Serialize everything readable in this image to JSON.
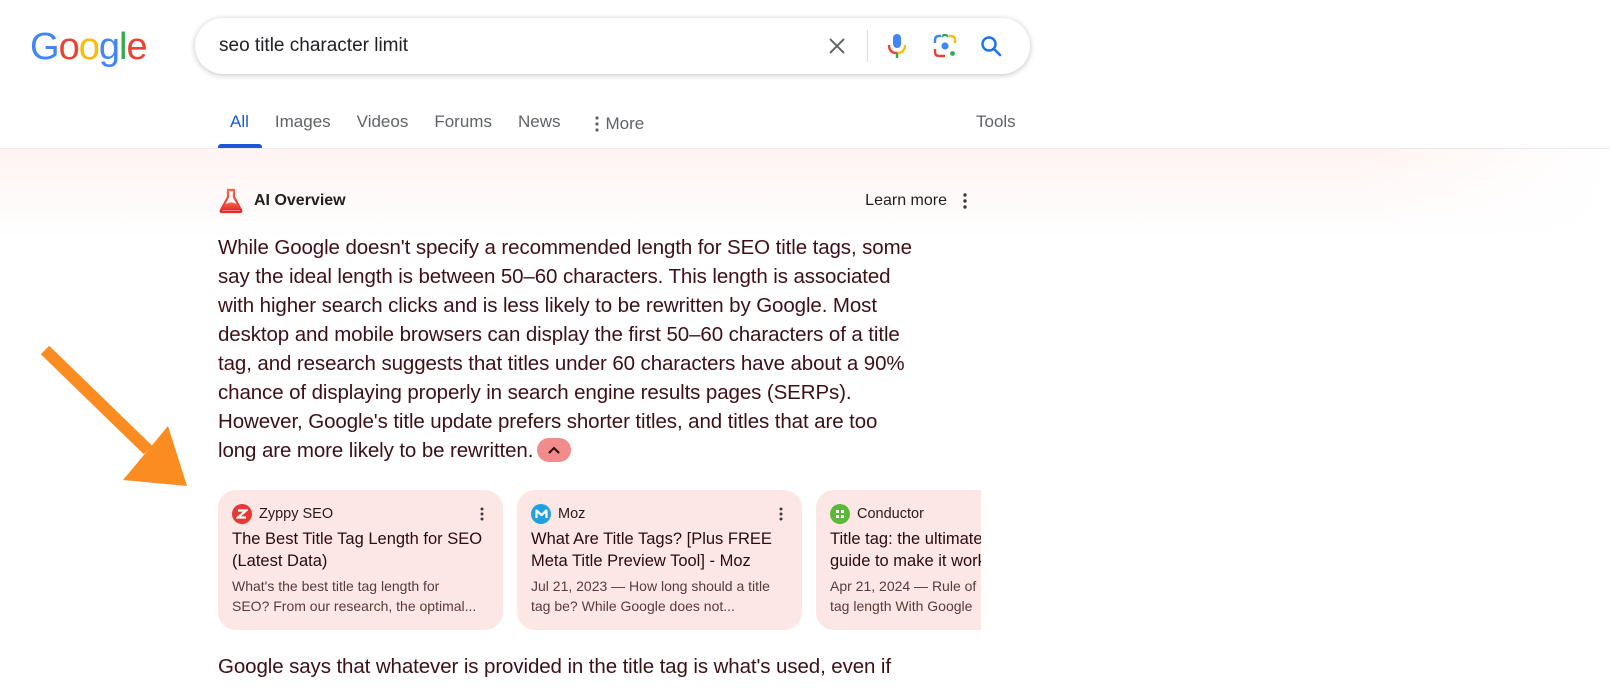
{
  "logo": {
    "text": "Google",
    "letters": [
      {
        "ch": "G",
        "color": "#4285F4"
      },
      {
        "ch": "o",
        "color": "#EA4335"
      },
      {
        "ch": "o",
        "color": "#FBBC05"
      },
      {
        "ch": "g",
        "color": "#4285F4"
      },
      {
        "ch": "l",
        "color": "#34A853"
      },
      {
        "ch": "e",
        "color": "#EA4335"
      }
    ]
  },
  "search": {
    "query": "seo title character limit",
    "icons": [
      "clear-icon",
      "microphone-icon",
      "google-lens-icon",
      "search-icon"
    ]
  },
  "tabs": [
    {
      "label": "All",
      "active": true
    },
    {
      "label": "Images",
      "active": false
    },
    {
      "label": "Videos",
      "active": false
    },
    {
      "label": "Forums",
      "active": false
    },
    {
      "label": "News",
      "active": false
    },
    {
      "label": "More",
      "active": false
    }
  ],
  "tools_label": "Tools",
  "ai_overview": {
    "title": "AI Overview",
    "learn_more": "Learn more",
    "body": "While Google doesn't specify a recommended length for SEO title tags, some say the ideal length is between 50–60 characters. This length is associated with higher search clicks and is less likely to be rewritten by Google. Most desktop and mobile browsers can display the first 50–60 characters of a title tag, and research suggests that titles under 60 characters have about a 90% chance of displaying properly in search engine results pages (SERPs). However, Google's title update prefers shorter titles, and titles that are too long are more likely to be rewritten.",
    "body_lines": [
      "While Google doesn't specify a recommended length for SEO title tags, some",
      "say the ideal length is between 50–60 characters. This length is associated",
      "with higher search clicks and is less likely to be rewritten by Google. Most",
      "desktop and mobile browsers can display the first 50–60 characters of a title",
      "tag, and research suggests that titles under 60 characters have about a 90%",
      "chance of displaying properly in search engine results pages (SERPs).",
      "However, Google's title update prefers shorter titles, and titles that are too",
      "long are more likely to be rewritten."
    ],
    "sources": [
      {
        "site": "Zyppy SEO",
        "title_lines": [
          "The Best Title Tag Length for SEO",
          "(Latest Data)"
        ],
        "snippet_lines": [
          "What's the best title tag length for",
          "SEO? From our research, the optimal..."
        ],
        "favicon_color": "#e53935"
      },
      {
        "site": "Moz",
        "title_lines": [
          "What Are Title Tags? [Plus FREE",
          "Meta Title Preview Tool] - Moz"
        ],
        "snippet_lines": [
          "Jul 21, 2023 — How long should a title",
          "tag be? While Google does not..."
        ],
        "favicon_color": "#1ea1e0"
      },
      {
        "site": "Conductor",
        "title_lines": [
          "Title tag: the ultimate",
          "guide to make it work"
        ],
        "snippet_lines": [
          "Apr 21, 2024 — Rule of",
          "tag length With Google"
        ],
        "favicon_color": "#5cb83a"
      }
    ],
    "continued_text": "Google says that whatever is provided in the title tag is what's used, even if"
  },
  "colors": {
    "accent_blue": "#1a57d4",
    "card_bg": "#fde7e5",
    "annotation_arrow": "#fb8c22"
  }
}
